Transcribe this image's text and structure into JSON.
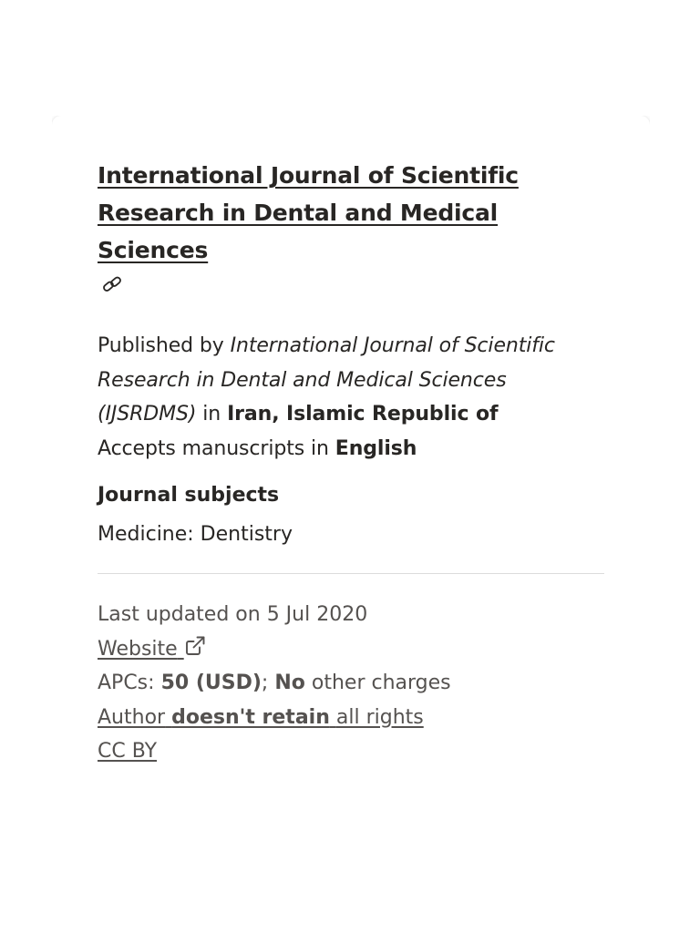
{
  "journal": {
    "title": "International Journal of Scientific Research in Dental and Medical Sciences"
  },
  "publisher": {
    "prefix": "Published by",
    "name": "International Journal of Scientific Research in Dental and Medical Sciences (IJSRDMS)",
    "in_word": "in",
    "country": "Iran, Islamic Republic of",
    "manuscripts_prefix": "Accepts manuscripts in",
    "language": "English"
  },
  "subjects": {
    "heading": "Journal subjects",
    "value": "Medicine: Dentistry"
  },
  "meta": {
    "last_updated": "Last updated on 5 Jul 2020",
    "website_label": "Website",
    "apcs_prefix": "APCs:",
    "apcs_amount": "50 (USD)",
    "apcs_separator": ";",
    "other_charges_bold": "No",
    "other_charges_text": "other charges",
    "author_prefix": "Author",
    "author_bold": "doesn't retain",
    "author_suffix": "all rights",
    "license": "CC BY"
  },
  "icons": {
    "permalink": "link-icon",
    "external": "external-link-icon"
  }
}
